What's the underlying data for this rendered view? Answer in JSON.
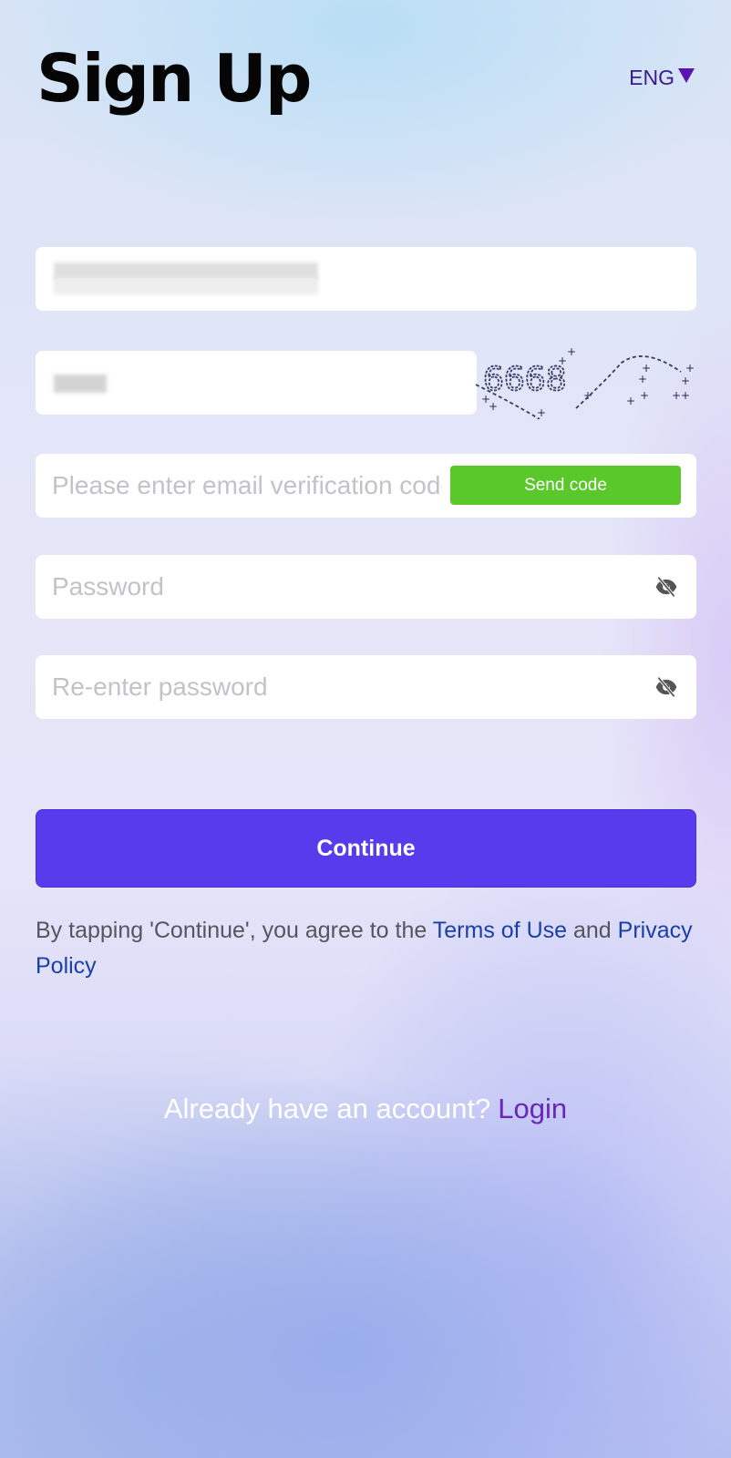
{
  "header": {
    "title": "Sign Up",
    "language": "ENG",
    "language_icon": "caret-down-icon"
  },
  "form": {
    "email": {
      "value": "[redacted]mail.com",
      "note": "value partially obscured in screenshot"
    },
    "captcha": {
      "value": "[redacted]",
      "image_text": "6668",
      "note": "input value obscured in screenshot"
    },
    "verification_code": {
      "placeholder": "Please enter email verification code",
      "send_button": "Send code"
    },
    "password": {
      "placeholder": "Password",
      "toggle_icon": "eye-slash-icon"
    },
    "confirm_password": {
      "placeholder": "Re-enter password",
      "toggle_icon": "eye-slash-icon"
    },
    "continue_button": "Continue"
  },
  "terms": {
    "prefix": "By tapping 'Continue', you agree to the ",
    "terms_link": "Terms of Use",
    "and": " and ",
    "privacy_link": "Privacy Policy"
  },
  "footer": {
    "prompt": "Already have an account?",
    "login_link": "Login"
  },
  "colors": {
    "primary": "#573bec",
    "send_code": "#5ac72a",
    "link": "#1a3fa8",
    "login_link": "#6a26b8",
    "language": "#3a1a8c"
  }
}
